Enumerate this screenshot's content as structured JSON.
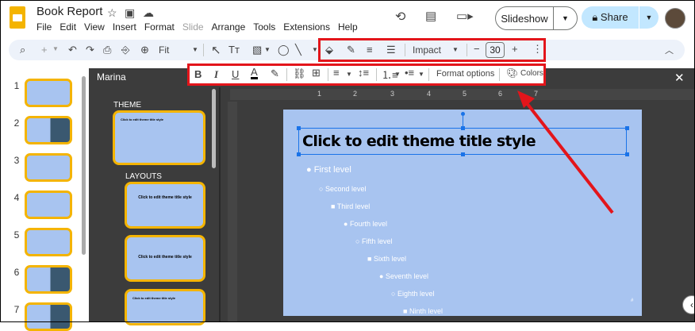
{
  "header": {
    "title": "Book Report",
    "menu": [
      "File",
      "Edit",
      "View",
      "Insert",
      "Format",
      "Slide",
      "Arrange",
      "Tools",
      "Extensions",
      "Help"
    ],
    "disabled_menu": "Slide",
    "slideshow_label": "Slideshow",
    "share_label": "Share"
  },
  "toolbar": {
    "zoom": "Fit",
    "font": "Impact",
    "font_size": "30"
  },
  "format_bar": {
    "format_options_label": "Format options",
    "colors_label": "Colors"
  },
  "filmstrip": {
    "slides": [
      "1",
      "2",
      "3",
      "4",
      "5",
      "6",
      "7"
    ]
  },
  "theme_panel": {
    "theme_name": "Marina",
    "theme_label": "THEME",
    "layouts_label": "LAYOUTS",
    "layout_title": "Click to edit theme title style"
  },
  "ruler": [
    "1",
    "2",
    "3",
    "4",
    "5",
    "6",
    "7"
  ],
  "slide": {
    "title": "Click to edit theme title style",
    "levels": [
      "First level",
      "Second level",
      "Third level",
      "Fourth level",
      "Fifth level",
      "Sixth level",
      "Seventh level",
      "Eighth level",
      "Ninth level"
    ],
    "page_num": "#"
  },
  "colors": {
    "accent_red": "#e3151b",
    "thumb_border": "#f4b400",
    "slide_bg": "#a8c4f0",
    "dark_bg": "#3c3c3c"
  }
}
